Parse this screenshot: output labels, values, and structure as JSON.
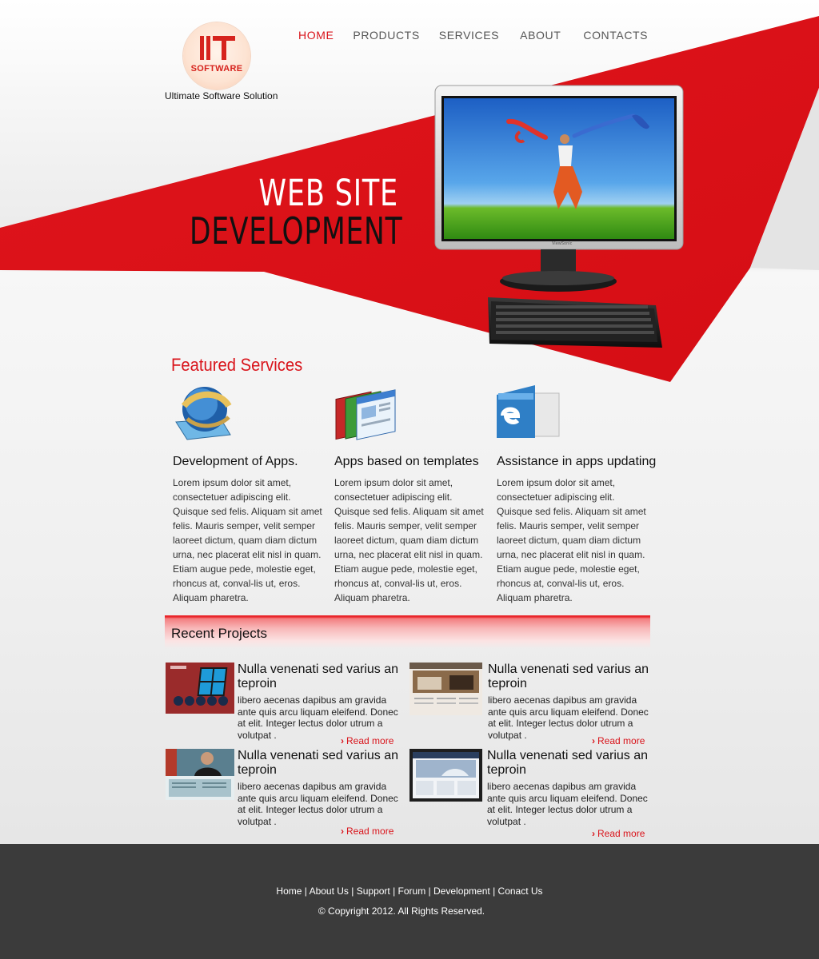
{
  "brand": {
    "logo_text": "SOFTWARE",
    "tagline": "Ultimate Software Solution"
  },
  "nav": [
    {
      "label": "HOME",
      "active": true
    },
    {
      "label": "PRODUCTS",
      "active": false
    },
    {
      "label": "SERVICES",
      "active": false
    },
    {
      "label": "ABOUT",
      "active": false
    },
    {
      "label": "CONTACTS",
      "active": false
    }
  ],
  "hero": {
    "line1": "WEB SITE",
    "line2": "DEVELOPMENT",
    "monitor_brand": "ViewSonic"
  },
  "featured": {
    "title": "Featured Services",
    "items": [
      {
        "icon": "globe-icon",
        "title": "Development of Apps.",
        "text": "Lorem ipsum dolor sit amet, consectetuer adipiscing elit. Quisque sed felis. Aliquam sit amet felis. Mauris semper, velit semper laoreet dictum, quam diam dictum urna, nec placerat elit nisl in quam. Etiam augue pede, molestie eget, rhoncus at, conval-lis ut, eros. Aliquam pharetra."
      },
      {
        "icon": "templates-icon",
        "title": "Apps based on templates",
        "text": "Lorem ipsum dolor sit amet, consectetuer adipiscing elit. Quisque sed felis. Aliquam sit amet felis. Mauris semper, velit semper laoreet dictum, quam diam dictum urna, nec placerat elit nisl in quam. Etiam augue pede, molestie eget, rhoncus at, conval-lis ut, eros. Aliquam pharetra."
      },
      {
        "icon": "browser-update-icon",
        "title": "Assistance in apps updating",
        "text": "Lorem ipsum dolor sit amet, consectetuer adipiscing elit. Quisque sed felis. Aliquam sit amet felis. Mauris semper, velit semper laoreet dictum, quam diam dictum urna, nec placerat elit nisl in quam. Etiam augue pede, molestie eget, rhoncus at, conval-lis ut, eros. Aliquam pharetra."
      }
    ]
  },
  "recent": {
    "title": "Recent Projects",
    "read_more": "Read more",
    "items": [
      {
        "title": "Nulla venenati sed varius an teproin",
        "text": "libero aecenas dapibus am gravida ante quis arcu liquam eleifend. Donec at elit. Integer lectus dolor utrum a volutpat ."
      },
      {
        "title": "Nulla venenati sed varius an teproin",
        "text": "libero aecenas dapibus am gravida ante quis arcu liquam eleifend. Donec at elit. Integer lectus dolor utrum a volutpat ."
      },
      {
        "title": "Nulla venenati sed varius an teproin",
        "text": "libero aecenas dapibus am gravida ante quis arcu liquam eleifend. Donec at elit. Integer lectus dolor utrum a volutpat ."
      },
      {
        "title": "Nulla venenati sed varius an teproin",
        "text": "libero aecenas dapibus am gravida ante quis arcu liquam eleifend. Donec at elit. Integer lectus dolor utrum a volutpat ."
      }
    ]
  },
  "footer": {
    "links": [
      "Home",
      "About Us",
      "Support",
      "Forum",
      "Development",
      "Conact Us"
    ],
    "copyright": "© Copyright 2012. All Rights Reserved."
  },
  "colors": {
    "accent": "#d9141b",
    "footer_bg": "#3b3b3b"
  }
}
